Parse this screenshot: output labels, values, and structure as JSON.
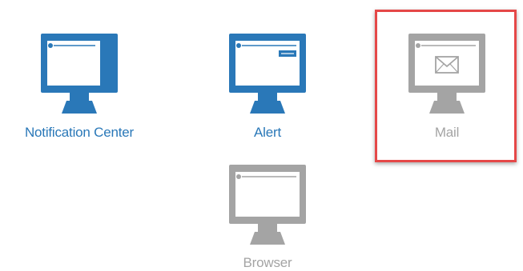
{
  "tiles": {
    "notification_center": {
      "label": "Notification Center",
      "state": "active"
    },
    "alert": {
      "label": "Alert",
      "state": "active"
    },
    "mail": {
      "label": "Mail",
      "state": "inactive",
      "highlighted": true
    },
    "browser": {
      "label": "Browser",
      "state": "inactive"
    }
  },
  "colors": {
    "active": "#2a78b8",
    "inactive": "#a4a4a4",
    "highlight_border": "#e54848"
  },
  "icons": {
    "notification_center": "monitor-notification-icon",
    "alert": "monitor-alert-icon",
    "mail": "monitor-mail-icon",
    "browser": "monitor-browser-icon"
  }
}
